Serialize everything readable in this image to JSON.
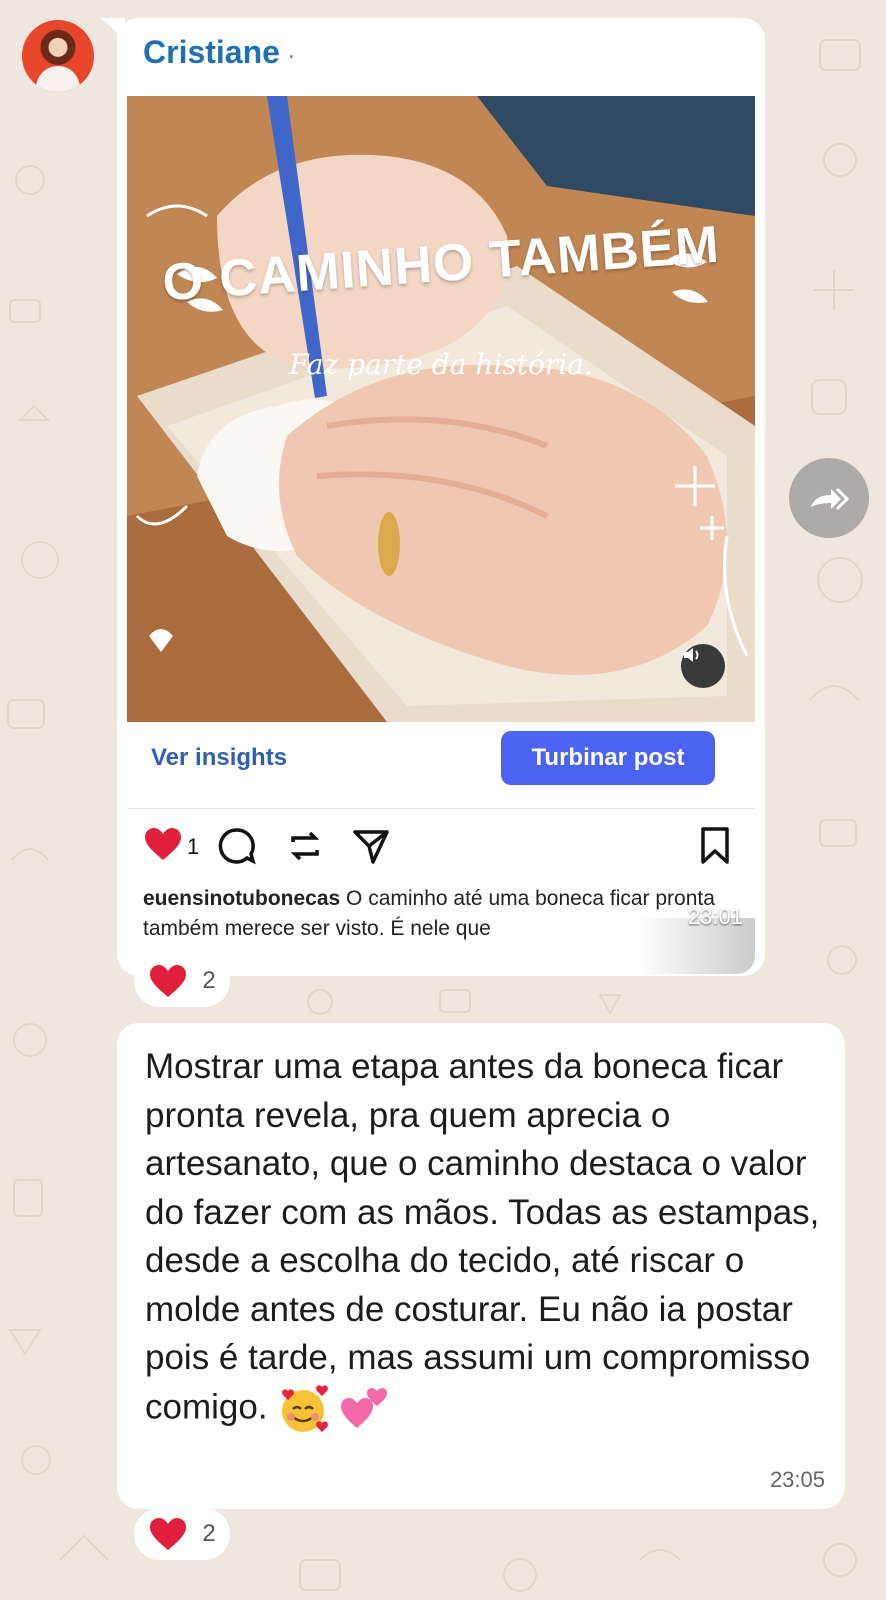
{
  "chat": {
    "sender_name": "Cristiane",
    "sender_name_suffix": "·"
  },
  "shared_post": {
    "overlay_title": "O CAMINHO TAMBÉM",
    "overlay_subtitle": "Faz parte da história.",
    "insights_label": "Ver insights",
    "boost_label": "Turbinar post",
    "like_count": "1",
    "caption_username": "euensinotubonecas",
    "caption_text": " O caminho até uma boneca ficar pronta também merece ser visto. É nele que",
    "time": "23:01",
    "reaction_emoji": "heart",
    "reaction_count": "2"
  },
  "text_message": {
    "body": "Mostrar uma etapa antes da boneca ficar pronta revela, pra quem aprecia o artesanato, que o caminho destaca o valor do fazer com as mãos. Todas as estampas, desde a escolha do tecido, até riscar o molde antes de costurar. Eu não ia postar pois é tarde, mas assumi um compromisso comigo.",
    "emojis": [
      "smiling-face-with-hearts",
      "two-hearts"
    ],
    "time": "23:05",
    "reaction_emoji": "heart",
    "reaction_count": "2"
  },
  "icons": {
    "avatar": "avatar",
    "like": "heart-icon",
    "comment": "comment-icon",
    "repost": "repost-icon",
    "share": "send-icon",
    "save": "bookmark-icon",
    "sound": "speaker-icon",
    "forward": "forward-icon"
  },
  "colors": {
    "chat_background": "#efe7dd",
    "bubble": "#ffffff",
    "sender_name": "#1f6fb5",
    "boost_button": "#4b63f3",
    "insights_link": "#2f5fb3",
    "like_heart": "#e0203a"
  }
}
